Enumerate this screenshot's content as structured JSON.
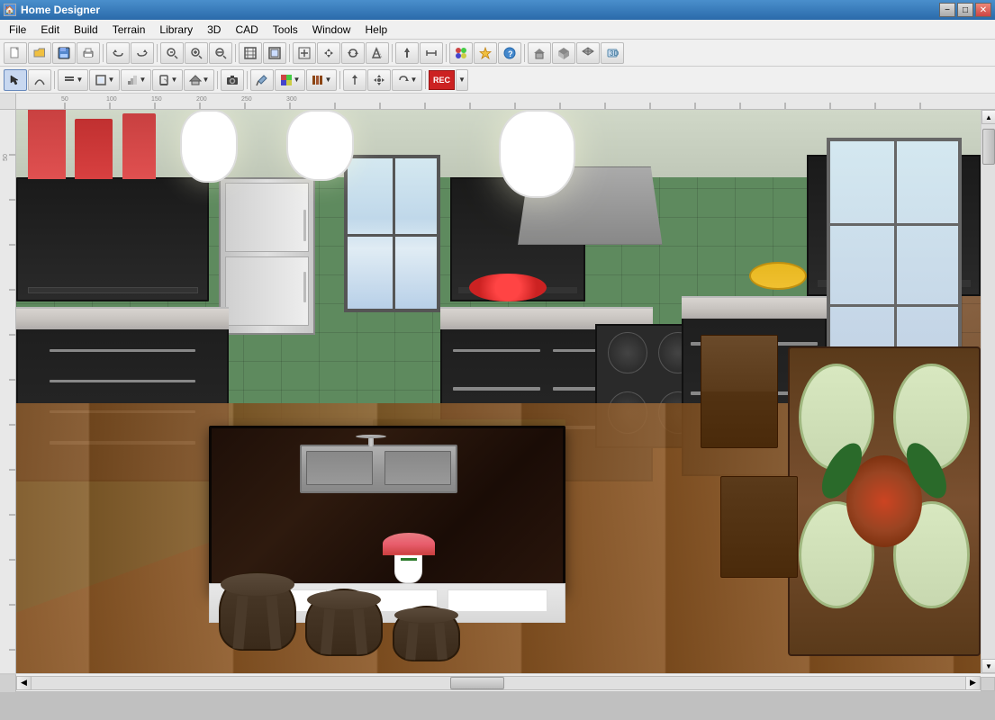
{
  "window": {
    "title": "Home Designer",
    "icon": "🏠"
  },
  "titlebar": {
    "minimize_label": "−",
    "maximize_label": "□",
    "close_label": "✕",
    "inner_minimize": "−",
    "inner_maximize": "□",
    "inner_close": "✕"
  },
  "menubar": {
    "items": [
      {
        "id": "file",
        "label": "File"
      },
      {
        "id": "edit",
        "label": "Edit"
      },
      {
        "id": "build",
        "label": "Build"
      },
      {
        "id": "terrain",
        "label": "Terrain"
      },
      {
        "id": "library",
        "label": "Library"
      },
      {
        "id": "3d",
        "label": "3D"
      },
      {
        "id": "cad",
        "label": "CAD"
      },
      {
        "id": "tools",
        "label": "Tools"
      },
      {
        "id": "window",
        "label": "Window"
      },
      {
        "id": "help",
        "label": "Help"
      }
    ]
  },
  "toolbar1": {
    "buttons": [
      {
        "id": "new",
        "icon": "📄",
        "tooltip": "New"
      },
      {
        "id": "open",
        "icon": "📁",
        "tooltip": "Open"
      },
      {
        "id": "save",
        "icon": "💾",
        "tooltip": "Save"
      },
      {
        "id": "print",
        "icon": "🖨",
        "tooltip": "Print"
      },
      {
        "id": "undo",
        "icon": "↩",
        "tooltip": "Undo"
      },
      {
        "id": "redo",
        "icon": "↪",
        "tooltip": "Redo"
      },
      {
        "id": "zoom-out-btn",
        "icon": "🔍",
        "tooltip": "Zoom Out"
      },
      {
        "id": "zoom-in-circle",
        "icon": "⊕",
        "tooltip": "Zoom In"
      },
      {
        "id": "zoom-out-circle",
        "icon": "⊖",
        "tooltip": "Zoom Out"
      },
      {
        "id": "fit",
        "icon": "⊞",
        "tooltip": "Fit to Window"
      },
      {
        "id": "move",
        "icon": "⊡",
        "tooltip": "Move"
      },
      {
        "id": "add",
        "icon": "⊕",
        "tooltip": "Add"
      },
      {
        "id": "rotate",
        "icon": "↻",
        "tooltip": "Rotate"
      },
      {
        "id": "mirror",
        "icon": "↔",
        "tooltip": "Mirror"
      },
      {
        "id": "arrow-up",
        "icon": "↑",
        "tooltip": "Arrow"
      },
      {
        "id": "dimension",
        "icon": "↕",
        "tooltip": "Dimension"
      },
      {
        "id": "materials",
        "icon": "🎨",
        "tooltip": "Materials"
      },
      {
        "id": "help-btn",
        "icon": "?",
        "tooltip": "Help"
      },
      {
        "id": "sep1",
        "separator": true
      },
      {
        "id": "roof1",
        "icon": "⌂",
        "tooltip": "Roof 1"
      },
      {
        "id": "roof2",
        "icon": "⌂",
        "tooltip": "Roof 2"
      },
      {
        "id": "roof3",
        "icon": "⌂",
        "tooltip": "Roof 3"
      },
      {
        "id": "roof4",
        "icon": "⌂",
        "tooltip": "Roof 4"
      }
    ]
  },
  "toolbar2": {
    "buttons": [
      {
        "id": "select",
        "icon": "↖",
        "tooltip": "Select"
      },
      {
        "id": "arc",
        "icon": "⌒",
        "tooltip": "Arc"
      },
      {
        "id": "wall-dd",
        "icon": "═",
        "tooltip": "Wall",
        "dropdown": true
      },
      {
        "id": "room-dd",
        "icon": "▦",
        "tooltip": "Room",
        "dropdown": true
      },
      {
        "id": "stair-dd",
        "icon": "▤",
        "tooltip": "Stairs",
        "dropdown": true
      },
      {
        "id": "door",
        "icon": "▭",
        "tooltip": "Door"
      },
      {
        "id": "roof-dd",
        "icon": "⌂",
        "tooltip": "Roof",
        "dropdown": true
      },
      {
        "id": "camera",
        "icon": "📷",
        "tooltip": "Camera"
      },
      {
        "id": "paint",
        "icon": "🖌",
        "tooltip": "Paint"
      },
      {
        "id": "material-dd",
        "icon": "🎨",
        "tooltip": "Material",
        "dropdown": true
      },
      {
        "id": "library-btn",
        "icon": "📚",
        "tooltip": "Library",
        "dropdown": true
      },
      {
        "id": "arrow-tool",
        "icon": "↑",
        "tooltip": "Arrow"
      },
      {
        "id": "move-tool",
        "icon": "✛",
        "tooltip": "Move"
      },
      {
        "id": "rotate-tool",
        "icon": "↻",
        "tooltip": "Rotate",
        "dropdown": true
      },
      {
        "id": "rec",
        "icon": "REC",
        "tooltip": "Record",
        "dropdown": true
      }
    ]
  },
  "canvas": {
    "scene_description": "3D kitchen interior view",
    "background_color": "#8B5E3C"
  },
  "scrollbars": {
    "vertical_up": "▲",
    "vertical_down": "▼",
    "horizontal_left": "◀",
    "horizontal_right": "▶"
  }
}
